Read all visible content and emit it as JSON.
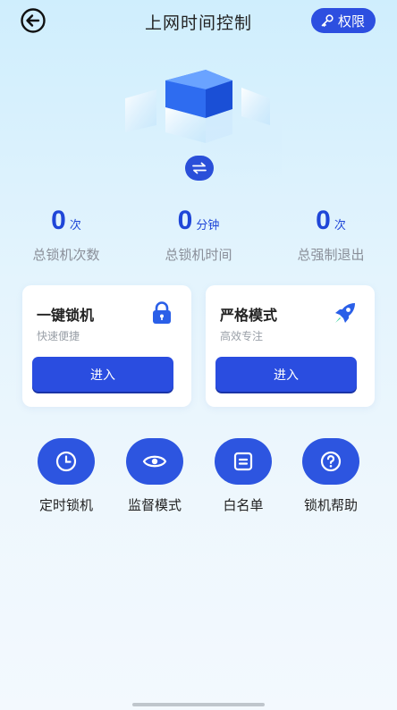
{
  "header": {
    "title": "上网时间控制",
    "permission_label": "权限"
  },
  "stats": [
    {
      "value": "0",
      "unit": "次",
      "label": "总锁机次数"
    },
    {
      "value": "0",
      "unit": "分钟",
      "label": "总锁机时间"
    },
    {
      "value": "0",
      "unit": "次",
      "label": "总强制退出"
    }
  ],
  "cards": [
    {
      "title": "一键锁机",
      "subtitle": "快速便捷",
      "button": "进入",
      "icon": "lock-icon"
    },
    {
      "title": "严格模式",
      "subtitle": "高效专注",
      "button": "进入",
      "icon": "rocket-icon"
    }
  ],
  "tools": [
    {
      "label": "定时锁机",
      "icon": "clock-icon"
    },
    {
      "label": "监督模式",
      "icon": "eye-icon"
    },
    {
      "label": "白名单",
      "icon": "list-icon"
    },
    {
      "label": "锁机帮助",
      "icon": "help-icon"
    }
  ],
  "colors": {
    "accent": "#2a4de0",
    "stat": "#1f46d8"
  }
}
